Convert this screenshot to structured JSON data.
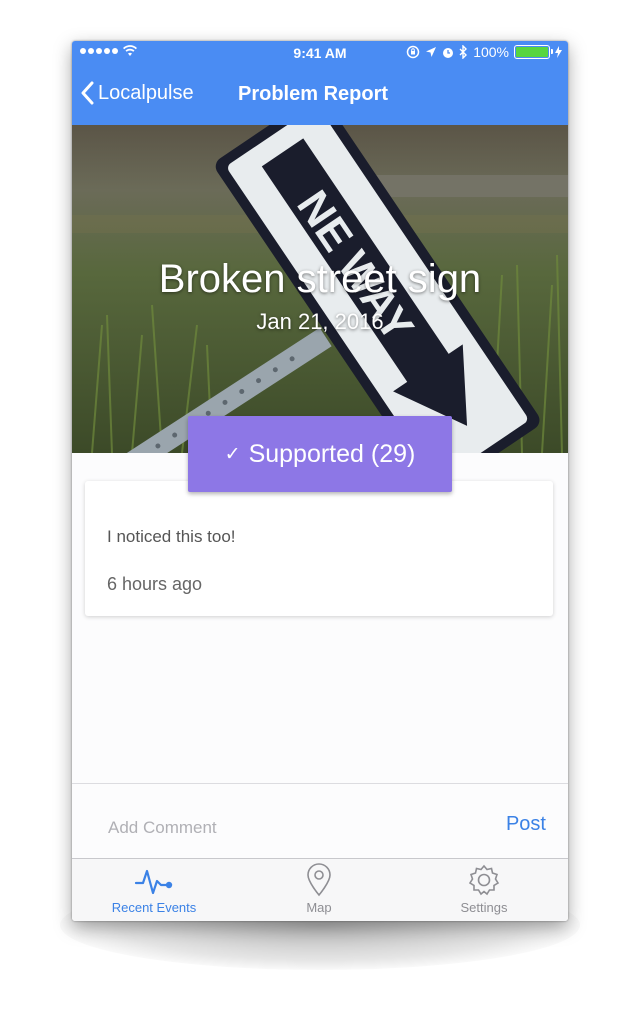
{
  "status_bar": {
    "time": "9:41 AM",
    "battery": "100%",
    "icons": [
      "signal-dots-icon",
      "wifi-icon",
      "rotation-lock-icon",
      "location-arrow-icon",
      "alarm-icon",
      "bluetooth-icon",
      "battery-icon"
    ]
  },
  "nav": {
    "back_label": "Localpulse",
    "title": "Problem Report"
  },
  "report": {
    "title": "Broken street sign",
    "date": "Jan 21, 2016"
  },
  "support": {
    "check": "✓",
    "label": "Supported (29)"
  },
  "comment": {
    "text": "I noticed this too!",
    "time": "6 hours ago"
  },
  "comment_bar": {
    "placeholder": "Add Comment",
    "post_label": "Post"
  },
  "tabs": [
    {
      "label": "Recent Events",
      "icon": "pulse-icon",
      "active": true
    },
    {
      "label": "Map",
      "icon": "map-pin-icon",
      "active": false
    },
    {
      "label": "Settings",
      "icon": "gear-icon",
      "active": false
    }
  ],
  "colors": {
    "nav_blue": "#4a8cf3",
    "support_purple": "#8d77e6",
    "active_tab_blue": "#3b82e6",
    "battery_green": "#57d53f"
  }
}
